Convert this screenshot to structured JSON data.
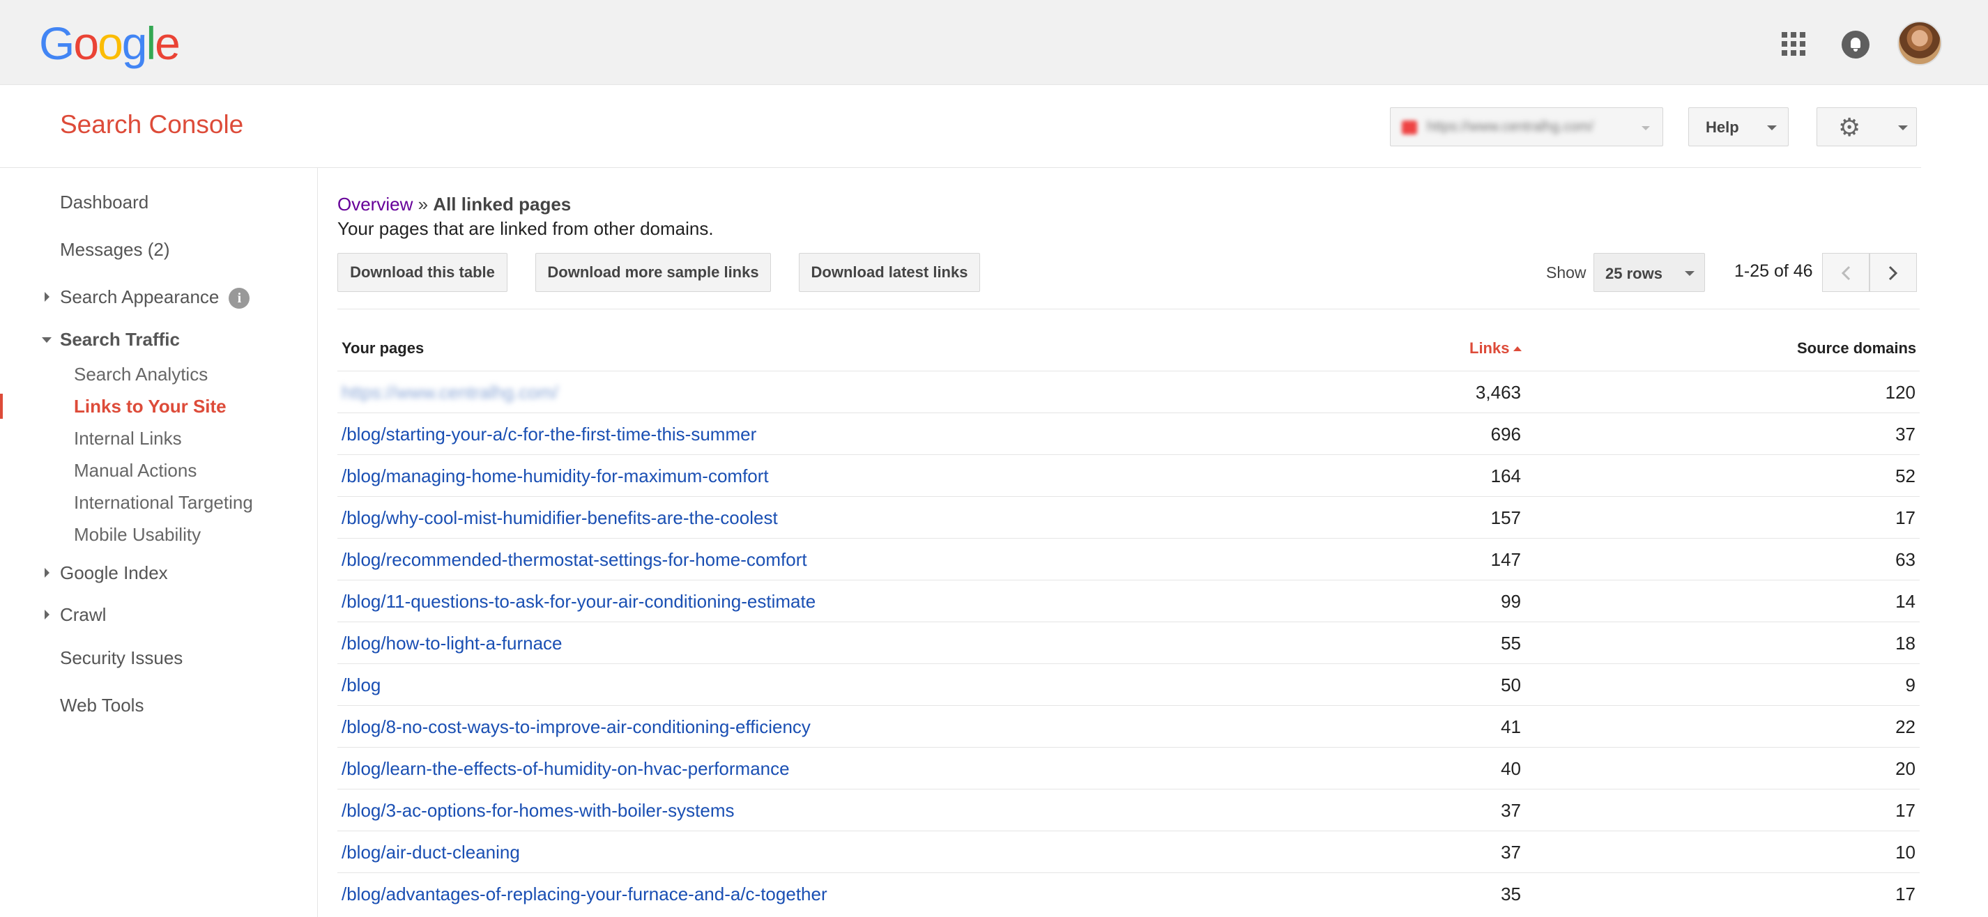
{
  "topbar": {
    "logo_letters": [
      {
        "ch": "G",
        "color": "#4285f4"
      },
      {
        "ch": "o",
        "color": "#ea4335"
      },
      {
        "ch": "o",
        "color": "#fbbc05"
      },
      {
        "ch": "g",
        "color": "#4285f4"
      },
      {
        "ch": "l",
        "color": "#34a853"
      },
      {
        "ch": "e",
        "color": "#ea4335"
      }
    ],
    "icons": [
      "apps-grid-icon",
      "notifications-bell-icon",
      "account-avatar"
    ]
  },
  "header": {
    "brand": "Search Console",
    "site_selector_value": "https://www.centralhg.com/",
    "help_label": "Help",
    "settings_icon": "gear-icon"
  },
  "sidebar": {
    "items": [
      {
        "label": "Dashboard"
      },
      {
        "label": "Messages (2)"
      },
      {
        "label": "Search Appearance"
      },
      {
        "label": "Search Traffic"
      },
      {
        "label": "Search Analytics"
      },
      {
        "label": "Links to Your Site"
      },
      {
        "label": "Internal Links"
      },
      {
        "label": "Manual Actions"
      },
      {
        "label": "International Targeting"
      },
      {
        "label": "Mobile Usability"
      },
      {
        "label": "Google Index"
      },
      {
        "label": "Crawl"
      },
      {
        "label": "Security Issues"
      },
      {
        "label": "Web Tools"
      }
    ],
    "info_glyph": "i"
  },
  "main": {
    "breadcrumb_link": "Overview",
    "breadcrumb_sep": "»",
    "breadcrumb_current": "All linked pages",
    "subtitle": "Your pages that are linked from other domains.",
    "buttons": {
      "download_table": "Download this table",
      "download_sample": "Download more sample links",
      "download_latest": "Download latest links"
    },
    "show_label": "Show",
    "rows_select": "25 rows",
    "range": "1-25 of 46"
  },
  "table": {
    "headers": {
      "pages": "Your pages",
      "links": "Links",
      "domains": "Source domains"
    },
    "rows": [
      {
        "url": "https://www.centralhg.com/",
        "links": "3,463",
        "domains": "120"
      },
      {
        "url": "/blog/starting-your-a/c-for-the-first-time-this-summer",
        "links": "696",
        "domains": "37"
      },
      {
        "url": "/blog/managing-home-humidity-for-maximum-comfort",
        "links": "164",
        "domains": "52"
      },
      {
        "url": "/blog/why-cool-mist-humidifier-benefits-are-the-coolest",
        "links": "157",
        "domains": "17"
      },
      {
        "url": "/blog/recommended-thermostat-settings-for-home-comfort",
        "links": "147",
        "domains": "63"
      },
      {
        "url": "/blog/11-questions-to-ask-for-your-air-conditioning-estimate",
        "links": "99",
        "domains": "14"
      },
      {
        "url": "/blog/how-to-light-a-furnace",
        "links": "55",
        "domains": "18"
      },
      {
        "url": "/blog",
        "links": "50",
        "domains": "9"
      },
      {
        "url": "/blog/8-no-cost-ways-to-improve-air-conditioning-efficiency",
        "links": "41",
        "domains": "22"
      },
      {
        "url": "/blog/learn-the-effects-of-humidity-on-hvac-performance",
        "links": "40",
        "domains": "20"
      },
      {
        "url": "/blog/3-ac-options-for-homes-with-boiler-systems",
        "links": "37",
        "domains": "17"
      },
      {
        "url": "/blog/air-duct-cleaning",
        "links": "37",
        "domains": "10"
      },
      {
        "url": "/blog/advantages-of-replacing-your-furnace-and-a/c-together",
        "links": "35",
        "domains": "17"
      }
    ]
  }
}
